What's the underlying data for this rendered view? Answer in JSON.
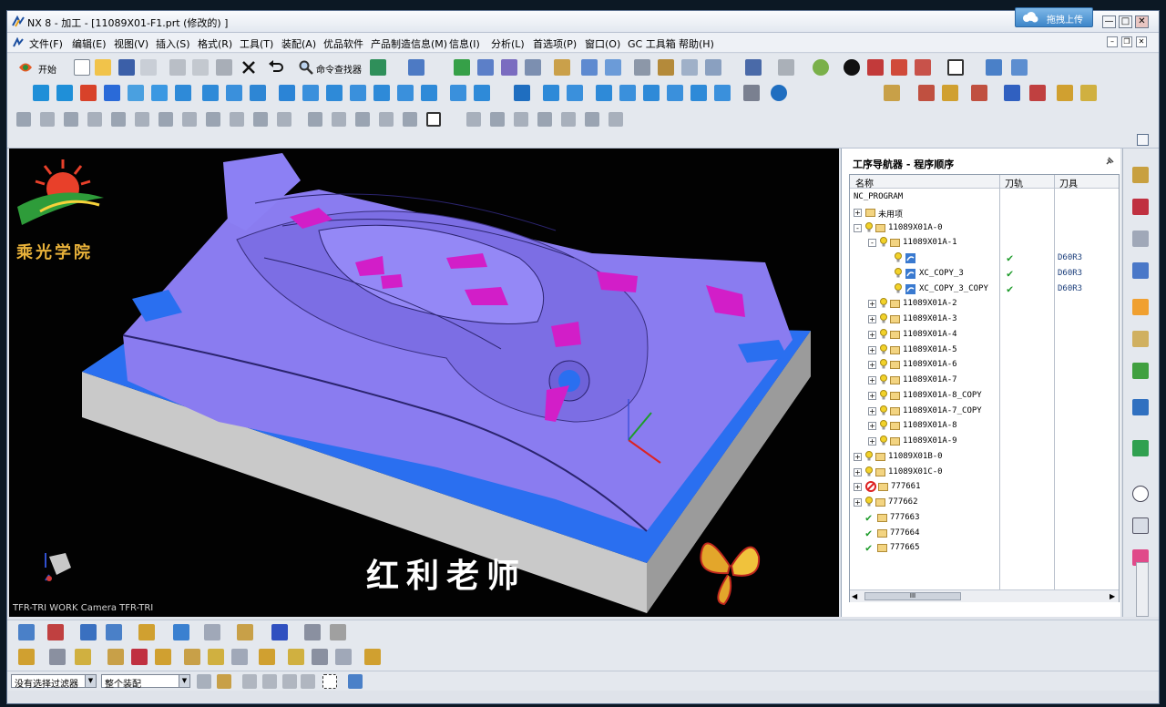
{
  "window": {
    "title": "NX 8 - 加工 - [11089X01-F1.prt (修改的) ]",
    "upload_label": "拖拽上传",
    "controls": [
      "—",
      "□",
      "✕"
    ]
  },
  "menu": [
    "文件(F)",
    "编辑(E)",
    "视图(V)",
    "插入(S)",
    "格式(R)",
    "工具(T)",
    "装配(A)",
    "优品软件",
    "产品制造信息(M)",
    "信息(I)",
    "分析(L)",
    "首选项(P)",
    "窗口(O)",
    "GC 工具箱",
    "帮助(H)"
  ],
  "toolbar": {
    "start_label": "开始",
    "command_finder": "命令查找器"
  },
  "viewport": {
    "caption": "TFR-TRI WORK Camera TFR-TRI",
    "logo_text": "乘光学院",
    "overlay_text": "红利老师"
  },
  "navigator": {
    "title": "工序导航器 - 程序顺序",
    "columns": [
      "名称",
      "刀轨",
      "刀具"
    ],
    "rows": [
      {
        "depth": 0,
        "expand": "",
        "icon": "none",
        "name": "NC_PROGRAM",
        "path": "",
        "tool": ""
      },
      {
        "depth": 0,
        "expand": "+",
        "icon": "folder",
        "name": "未用项",
        "path": "",
        "tool": ""
      },
      {
        "depth": 0,
        "expand": "-",
        "icon": "bulb-folder",
        "name": "11089X01A-0",
        "path": "",
        "tool": ""
      },
      {
        "depth": 1,
        "expand": "-",
        "icon": "bulb-folder",
        "name": "11089X01A-1",
        "path": "",
        "tool": ""
      },
      {
        "depth": 2,
        "expand": "",
        "icon": "bulb-op",
        "name": "",
        "path": "✔",
        "tool": "D60R3"
      },
      {
        "depth": 2,
        "expand": "",
        "icon": "bulb-op",
        "name": "XC_COPY_3",
        "path": "✔",
        "tool": "D60R3"
      },
      {
        "depth": 2,
        "expand": "",
        "icon": "bulb-op",
        "name": "XC_COPY_3_COPY",
        "path": "✔",
        "tool": "D60R3"
      },
      {
        "depth": 1,
        "expand": "+",
        "icon": "bulb-folder",
        "name": "11089X01A-2",
        "path": "",
        "tool": ""
      },
      {
        "depth": 1,
        "expand": "+",
        "icon": "bulb-folder",
        "name": "11089X01A-3",
        "path": "",
        "tool": ""
      },
      {
        "depth": 1,
        "expand": "+",
        "icon": "bulb-folder",
        "name": "11089X01A-4",
        "path": "",
        "tool": ""
      },
      {
        "depth": 1,
        "expand": "+",
        "icon": "bulb-folder",
        "name": "11089X01A-5",
        "path": "",
        "tool": ""
      },
      {
        "depth": 1,
        "expand": "+",
        "icon": "bulb-folder",
        "name": "11089X01A-6",
        "path": "",
        "tool": ""
      },
      {
        "depth": 1,
        "expand": "+",
        "icon": "bulb-folder",
        "name": "11089X01A-7",
        "path": "",
        "tool": ""
      },
      {
        "depth": 1,
        "expand": "+",
        "icon": "bulb-folder",
        "name": "11089X01A-8_COPY",
        "path": "",
        "tool": ""
      },
      {
        "depth": 1,
        "expand": "+",
        "icon": "bulb-folder",
        "name": "11089X01A-7_COPY",
        "path": "",
        "tool": ""
      },
      {
        "depth": 1,
        "expand": "+",
        "icon": "bulb-folder",
        "name": "11089X01A-8",
        "path": "",
        "tool": ""
      },
      {
        "depth": 1,
        "expand": "+",
        "icon": "bulb-folder",
        "name": "11089X01A-9",
        "path": "",
        "tool": ""
      },
      {
        "depth": 0,
        "expand": "+",
        "icon": "bulb-folder",
        "name": "11089X01B-0",
        "path": "",
        "tool": ""
      },
      {
        "depth": 0,
        "expand": "+",
        "icon": "bulb-folder",
        "name": "11089X01C-0",
        "path": "",
        "tool": ""
      },
      {
        "depth": 0,
        "expand": "+",
        "icon": "stop-folder",
        "name": "777661",
        "path": "",
        "tool": ""
      },
      {
        "depth": 0,
        "expand": "+",
        "icon": "bulb-folder",
        "name": "777662",
        "path": "",
        "tool": ""
      },
      {
        "depth": 0,
        "expand": "",
        "icon": "check-folder",
        "name": "777663",
        "path": "",
        "tool": ""
      },
      {
        "depth": 0,
        "expand": "",
        "icon": "check-folder",
        "name": "777664",
        "path": "",
        "tool": ""
      },
      {
        "depth": 0,
        "expand": "",
        "icon": "check-folder",
        "name": "777665",
        "path": "",
        "tool": ""
      }
    ],
    "hscroll_thumb": "III"
  },
  "status": {
    "filter_value": "没有选择过滤器",
    "scope_value": "整个装配"
  },
  "colors": {
    "part_purple": "#8a7cf0",
    "pocket_magenta": "#d21ec8",
    "floor_blue": "#2a6ff0",
    "check_green": "#1d9b2a"
  }
}
